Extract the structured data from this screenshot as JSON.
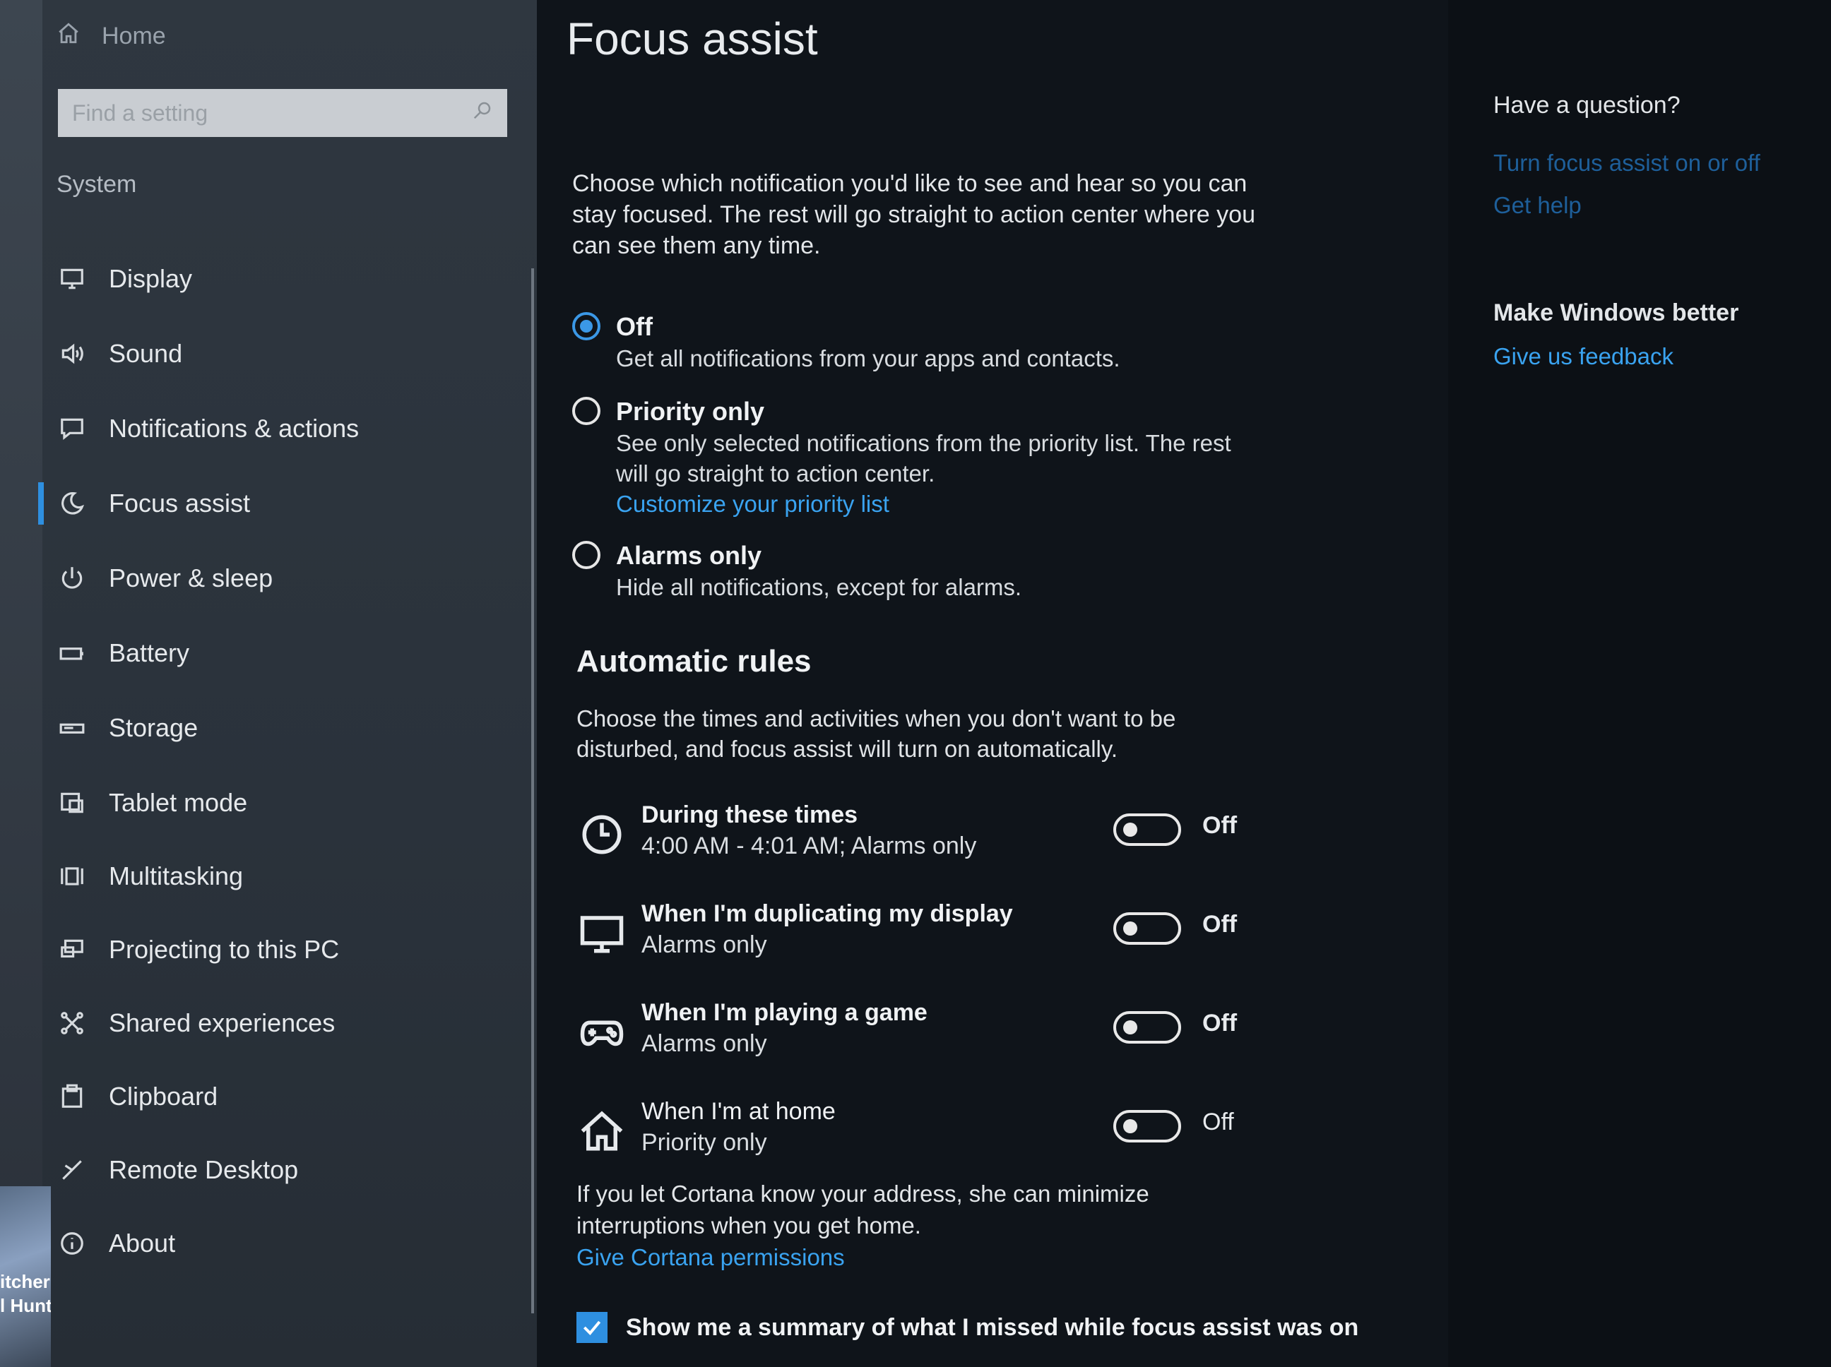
{
  "sidebar": {
    "home_label": "Home",
    "search_placeholder": "Find a setting",
    "section_label": "System",
    "items": [
      {
        "label": "Display",
        "icon": "monitor-icon"
      },
      {
        "label": "Sound",
        "icon": "speaker-icon"
      },
      {
        "label": "Notifications & actions",
        "icon": "notification-icon"
      },
      {
        "label": "Focus assist",
        "icon": "moon-icon",
        "active": true
      },
      {
        "label": "Power & sleep",
        "icon": "power-icon"
      },
      {
        "label": "Battery",
        "icon": "battery-icon"
      },
      {
        "label": "Storage",
        "icon": "storage-icon"
      },
      {
        "label": "Tablet mode",
        "icon": "tablet-icon"
      },
      {
        "label": "Multitasking",
        "icon": "multitasking-icon"
      },
      {
        "label": "Projecting to this PC",
        "icon": "projecting-icon"
      },
      {
        "label": "Shared experiences",
        "icon": "shared-icon"
      },
      {
        "label": "Clipboard",
        "icon": "clipboard-icon"
      },
      {
        "label": "Remote Desktop",
        "icon": "remote-desktop-icon"
      },
      {
        "label": "About",
        "icon": "info-icon"
      }
    ],
    "desktop_caption": [
      "itcher",
      "l Hunt"
    ]
  },
  "main": {
    "title": "Focus assist",
    "intro": "Choose which notification you'd like to see and hear so you can stay focused. The rest will go straight to action center where you can see them any time.",
    "options": [
      {
        "title": "Off",
        "desc": "Get all notifications from your apps and contacts.",
        "checked": true,
        "link": ""
      },
      {
        "title": "Priority only",
        "desc": "See only selected notifications from the priority list. The rest will go straight to action center.",
        "checked": false,
        "link": "Customize your priority list"
      },
      {
        "title": "Alarms only",
        "desc": "Hide all notifications, except for alarms.",
        "checked": false,
        "link": ""
      }
    ],
    "rules_title": "Automatic rules",
    "rules_desc": "Choose the times and activities when you don't want to be disturbed, and focus assist will turn on automatically.",
    "rules": [
      {
        "title": "During these times",
        "sub": "4:00 AM - 4:01 AM; Alarms only",
        "state": "Off",
        "icon": "clock-icon"
      },
      {
        "title": "When I'm duplicating my display",
        "sub": "Alarms only",
        "state": "Off",
        "icon": "monitor-icon"
      },
      {
        "title": "When I'm playing a game",
        "sub": "Alarms only",
        "state": "Off",
        "icon": "gamepad-icon"
      },
      {
        "title": "When I'm at home",
        "sub": "Priority only",
        "state": "Off",
        "icon": "home-icon"
      }
    ],
    "cortana_note": "If you let Cortana know your address, she can minimize interruptions when you get home.",
    "cortana_link": "Give Cortana permissions",
    "summary_label": "Show me a summary of what I missed while focus assist was on",
    "summary_checked": true
  },
  "right": {
    "question_heading": "Have a question?",
    "link_focus": "Turn focus assist on or off",
    "link_help": "Get help",
    "better_heading": "Make Windows better",
    "link_feedback": "Give us feedback"
  },
  "colors": {
    "accent": "#3b98e6",
    "link": "#3aa3f0",
    "background": "#0f141a",
    "sidebar": "#2c343d"
  }
}
